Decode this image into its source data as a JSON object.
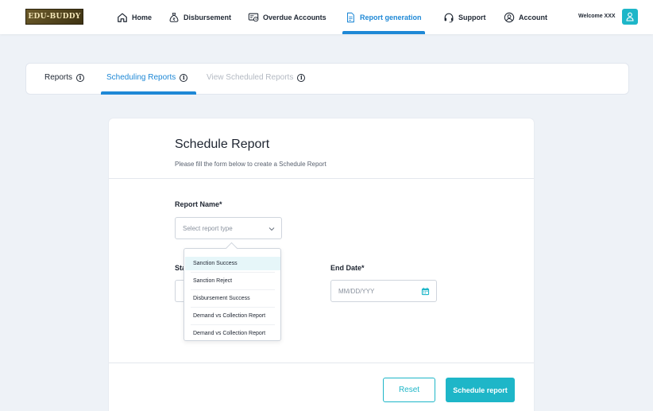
{
  "app": {
    "logo_text": "EDU-BUDDY",
    "welcome": "Welcome XXX"
  },
  "nav": {
    "items": [
      {
        "label": "Home",
        "icon": "home-icon"
      },
      {
        "label": "Disbursement",
        "icon": "money-bag-icon"
      },
      {
        "label": "Overdue Accounts",
        "icon": "overdue-accounts-icon"
      },
      {
        "label": "Report generation",
        "icon": "report-icon",
        "active": true
      },
      {
        "label": "Support",
        "icon": "headset-icon"
      },
      {
        "label": "Account",
        "icon": "user-circle-icon"
      }
    ]
  },
  "tabs": [
    {
      "label": "Reports"
    },
    {
      "label": "Scheduling Reports",
      "active": true
    },
    {
      "label": "View Scheduled Reports",
      "disabled": true
    }
  ],
  "form": {
    "title": "Schedule Report",
    "subtitle": "Please fill the form below to create a Schedule Report",
    "report_name_label": "Report Name*",
    "report_name_placeholder": "Select report type",
    "start_date_label_partial": "Sta",
    "end_date_label": "End Date*",
    "end_date_placeholder": "MM/DD/YYY",
    "reset_label": "Reset",
    "submit_label": "Schedule report"
  },
  "dropdown": {
    "options": [
      "Sanction Success",
      "Sanction Reject",
      "Disbursement Success",
      "Demand vs Collection Report",
      "Demand vs Collection Report"
    ],
    "highlighted_index": 0
  },
  "colors": {
    "accent_blue": "#1e88d6",
    "accent_teal": "#1eb6c8",
    "background": "#eef2f7"
  }
}
